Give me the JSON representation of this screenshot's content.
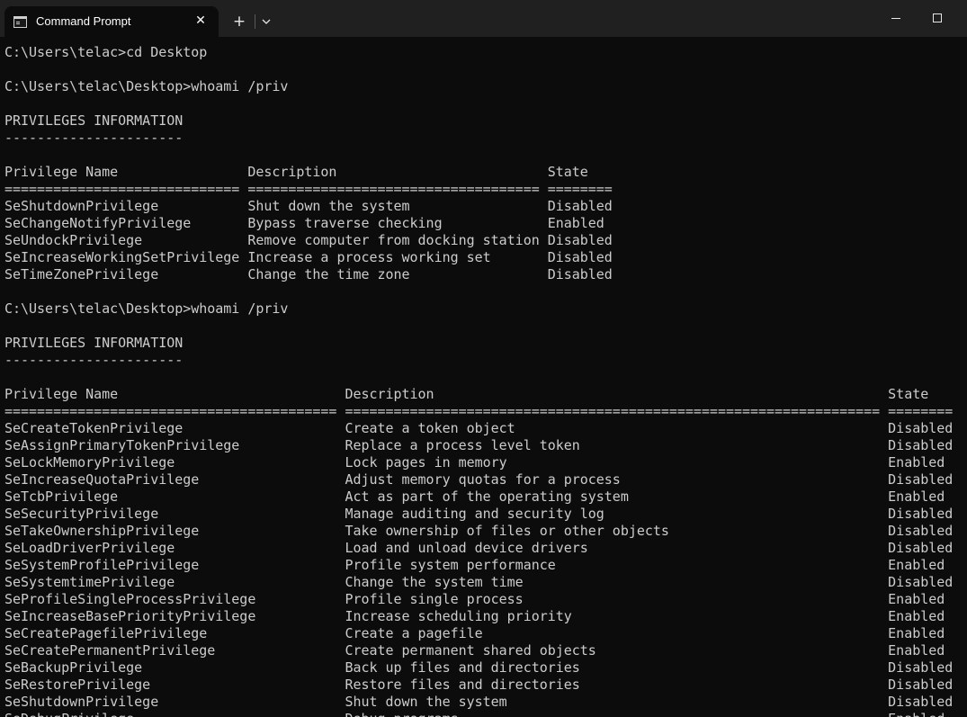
{
  "window": {
    "tab_title": "Command Prompt",
    "tab_close_glyph": "✕",
    "new_tab_glyph": "+",
    "icons": {
      "tab_icon": "command-prompt-icon",
      "close": "close-icon",
      "add": "plus-icon",
      "dropdown": "chevron-down-icon",
      "minimize": "minimize-icon",
      "maximize": "maximize-icon"
    },
    "colors": {
      "titlebar": "#202020",
      "background": "#0c0c0c",
      "text": "#cccccc"
    }
  },
  "console": {
    "lines": [
      "C:\\Users\\telac>cd Desktop",
      "",
      "C:\\Users\\telac\\Desktop>whoami /priv",
      "",
      "PRIVILEGES INFORMATION",
      "----------------------",
      "",
      "Privilege Name                Description                          State",
      "============================= ==================================== ========",
      "SeShutdownPrivilege           Shut down the system                 Disabled",
      "SeChangeNotifyPrivilege       Bypass traverse checking             Enabled",
      "SeUndockPrivilege             Remove computer from docking station Disabled",
      "SeIncreaseWorkingSetPrivilege Increase a process working set       Disabled",
      "SeTimeZonePrivilege           Change the time zone                 Disabled",
      "",
      "C:\\Users\\telac\\Desktop>whoami /priv",
      "",
      "PRIVILEGES INFORMATION",
      "----------------------",
      "",
      "Privilege Name                            Description                                                        State",
      "========================================= ================================================================== ========",
      "SeCreateTokenPrivilege                    Create a token object                                              Disabled",
      "SeAssignPrimaryTokenPrivilege             Replace a process level token                                      Disabled",
      "SeLockMemoryPrivilege                     Lock pages in memory                                               Enabled",
      "SeIncreaseQuotaPrivilege                  Adjust memory quotas for a process                                 Disabled",
      "SeTcbPrivilege                            Act as part of the operating system                                Enabled",
      "SeSecurityPrivilege                       Manage auditing and security log                                   Disabled",
      "SeTakeOwnershipPrivilege                  Take ownership of files or other objects                           Disabled",
      "SeLoadDriverPrivilege                     Load and unload device drivers                                     Disabled",
      "SeSystemProfilePrivilege                  Profile system performance                                         Enabled",
      "SeSystemtimePrivilege                     Change the system time                                             Disabled",
      "SeProfileSingleProcessPrivilege           Profile single process                                             Enabled",
      "SeIncreaseBasePriorityPrivilege           Increase scheduling priority                                       Enabled",
      "SeCreatePagefilePrivilege                 Create a pagefile                                                  Enabled",
      "SeCreatePermanentPrivilege                Create permanent shared objects                                    Enabled",
      "SeBackupPrivilege                         Back up files and directories                                      Disabled",
      "SeRestorePrivilege                        Restore files and directories                                      Disabled",
      "SeShutdownPrivilege                       Shut down the system                                               Disabled",
      "SeDebugPrivilege                          Debug programs                                                     Enabled"
    ]
  }
}
